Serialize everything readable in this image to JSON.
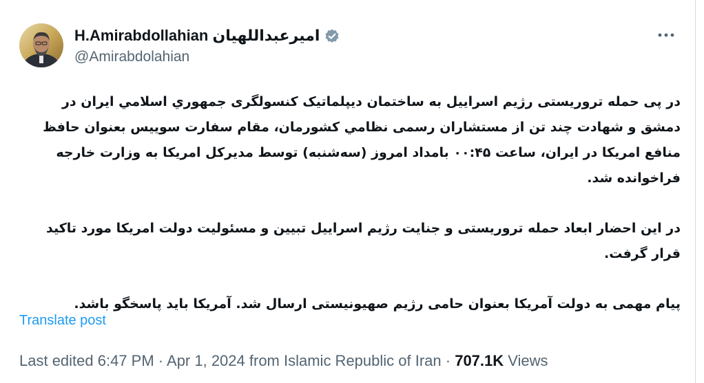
{
  "author": {
    "display_name": "H.Amirabdollahian امیرعبداللهیان",
    "handle": "@Amirabdolahian",
    "verified_icon": "verified-badge-icon"
  },
  "menu": {
    "icon": "more-options-icon",
    "label": "···"
  },
  "post": {
    "paragraphs": [
      "در پی حمله تروریستی رژیم اسراییل به ساختمان دیپلماتیک کنسولگری جمهوري اسلامي ایران در دمشق و شهادت چند تن از مستشاران رسمی نظامي کشورمان، مقام سفارت سوییس بعنوان حافظ منافع امریکا در ایران، ساعت ۰۰:۴۵ بامداد امروز (سه‌شنبه) توسط مديركل امريكا به وزارت خارجه فراخوانده شد.",
      "در این احضار ابعاد حمله تروریستی و جنایت رژیم اسراییل تبیین و مسئولیت دولت امریکا مورد تاکید قرار گرفت.",
      "پیام مهمی به دولت آمریکا بعنوان حامی رژیم صهیونیستی ارسال شد. آمریکا باید پاسخگو باشد."
    ],
    "translate_label": "Translate post"
  },
  "meta": {
    "edited_time": "Last edited 6:47 PM · Apr 1, 2024 from Islamic Republic of Iran · ",
    "views_count": "707.1K",
    "views_label": " Views"
  },
  "colors": {
    "link": "#1d9bf0",
    "secondary_text": "#536471",
    "primary_text": "#0f1419",
    "verified_badge": "#829aab"
  }
}
